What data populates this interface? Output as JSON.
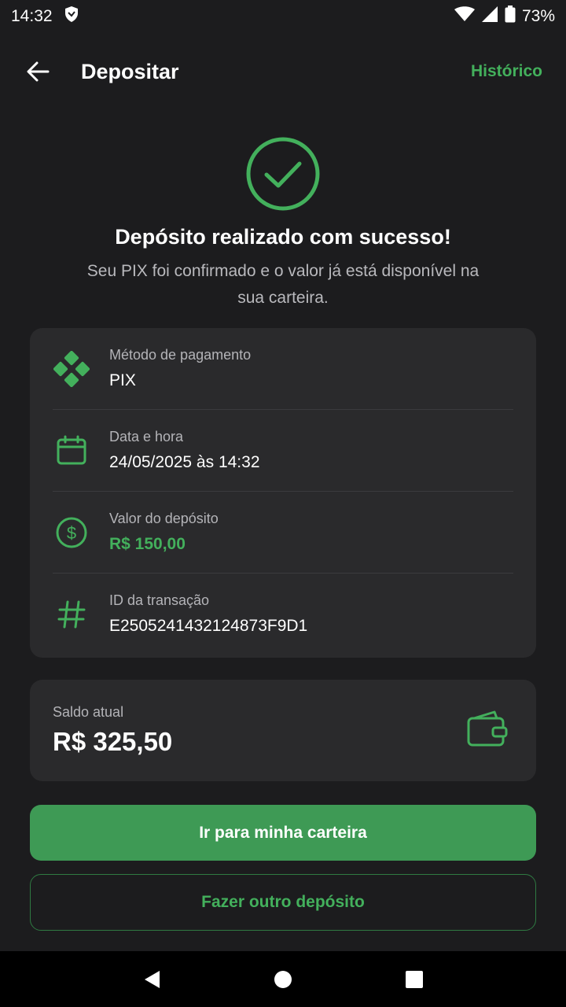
{
  "status_bar": {
    "time": "14:32",
    "battery": "73%"
  },
  "header": {
    "title": "Depositar",
    "history_link": "Histórico"
  },
  "success": {
    "title": "Depósito realizado com sucesso!",
    "subtitle": "Seu PIX foi confirmado e o valor já está disponível na sua carteira."
  },
  "details": [
    {
      "label": "Método de pagamento",
      "value": "PIX",
      "icon": "pix-icon"
    },
    {
      "label": "Data e hora",
      "value": "24/05/2025 às 14:32",
      "icon": "calendar-icon"
    },
    {
      "label": "Valor do depósito",
      "value": "R$ 150,00",
      "icon": "dollar-circle-icon"
    },
    {
      "label": "ID da transação",
      "value": "E2505241432124873F9D1",
      "icon": "hash-icon"
    }
  ],
  "balance": {
    "label": "Saldo atual",
    "value": "R$ 325,50",
    "icon": "wallet-icon"
  },
  "actions": {
    "primary": "Ir para minha carteira",
    "secondary": "Fazer outro depósito"
  },
  "colors": {
    "accent": "#43b05c",
    "background": "#1c1c1e",
    "card": "#2a2a2c"
  }
}
